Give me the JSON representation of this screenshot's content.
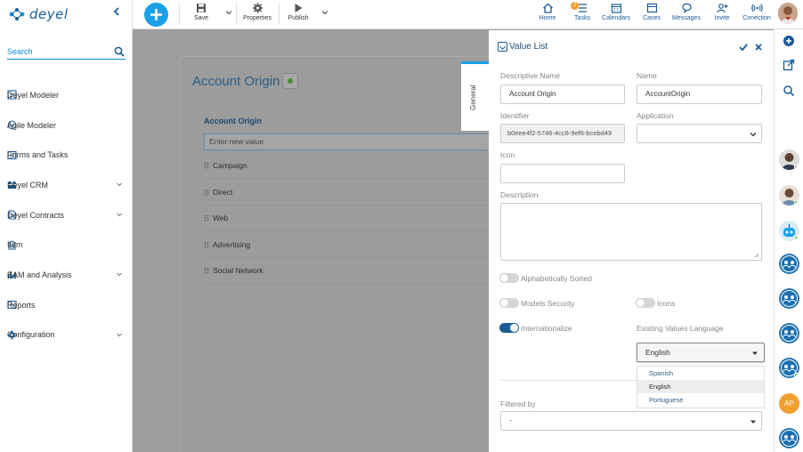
{
  "app": {
    "logo": "deyel"
  },
  "sidebar": {
    "search_placeholder": "Search",
    "items": [
      {
        "label": "Deyel Modeler",
        "icon": "modeler-icon",
        "expandable": false
      },
      {
        "label": "Agile Modeler",
        "icon": "agile-icon",
        "expandable": false
      },
      {
        "label": "Forms and Tasks",
        "icon": "forms-icon",
        "expandable": false
      },
      {
        "label": "Deyel CRM",
        "icon": "crm-icon",
        "expandable": true
      },
      {
        "label": "Deyel Contracts",
        "icon": "contracts-icon",
        "expandable": true
      },
      {
        "label": "Item",
        "icon": "item-icon",
        "expandable": false
      },
      {
        "label": "BAM and Analysis",
        "icon": "chart-icon",
        "expandable": true
      },
      {
        "label": "Reports",
        "icon": "reports-icon",
        "expandable": false
      },
      {
        "label": "Configuration",
        "icon": "gear-icon",
        "expandable": true
      }
    ]
  },
  "toolbar": {
    "save": "Save",
    "properties": "Properties",
    "publish": "Publish"
  },
  "topnav": {
    "home": "Home",
    "tasks": "Tasks",
    "tasks_badge": "2",
    "calendars": "Calendars",
    "cases": "Cases",
    "messages": "Messages",
    "invite": "Invite",
    "conection": "Conection"
  },
  "editor": {
    "title": "Account Origin",
    "list_header": "Account Origin",
    "new_value_placeholder": "Enter new value",
    "values": [
      "Campaign",
      "Direct",
      "Web",
      "Advertising",
      "Social Network"
    ],
    "tab_general": "General"
  },
  "panel": {
    "title": "Value List",
    "descriptive_name_label": "Descriptive Name",
    "descriptive_name_value": "Account Origin",
    "name_label": "Name",
    "name_value": "AccountOrigin",
    "identifier_label": "Identifier",
    "identifier_value": "b0eee4f2-5746-4cc8-9ef6-bcebd49",
    "application_label": "Application",
    "application_value": "",
    "icon_label": "Icon",
    "description_label": "Description",
    "alphabetically_sorted": "Alphabetically Sorted",
    "alphabetically_sorted_on": false,
    "models_security": "Models Security",
    "models_security_on": false,
    "icons": "Icons",
    "icons_on": false,
    "internationalize": "Internationalize",
    "internationalize_on": true,
    "existing_values_language_label": "Existing Values Language",
    "existing_values_language_value": "English",
    "language_options": [
      "Spanish",
      "English",
      "Portuguese"
    ],
    "filtered_by_label": "Filtered by",
    "filtered_by_value": "-"
  },
  "rail": {
    "ap_initials": "AP"
  },
  "colors": {
    "brand": "#1a5c99",
    "accent": "#1aa0e6",
    "online": "#4cc14c",
    "ap_avatar": "#f0a030"
  }
}
